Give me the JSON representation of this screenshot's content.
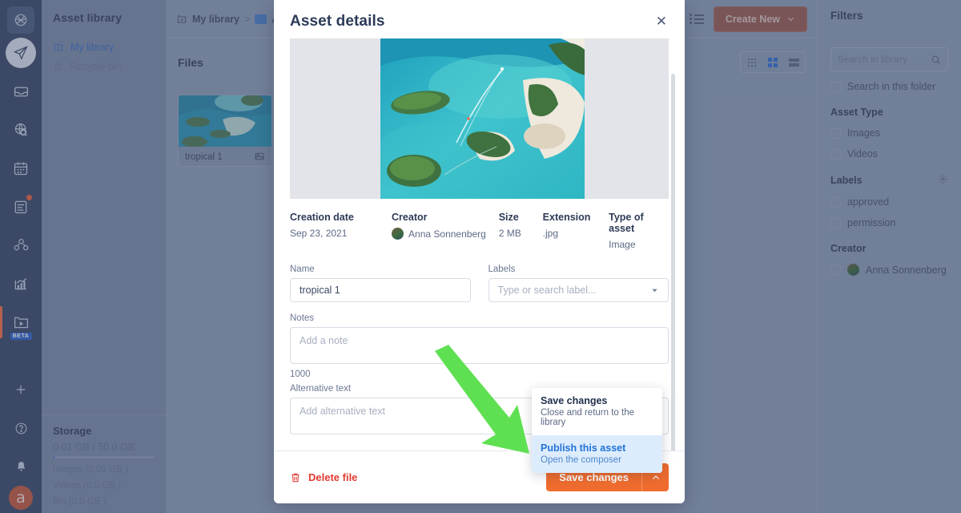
{
  "rail": {
    "logo_icon": "brand-logo-icon",
    "items": [
      {
        "name": "publisher",
        "icon": "paper-plane-icon"
      },
      {
        "name": "inbox",
        "icon": "inbox-tray-icon"
      },
      {
        "name": "monitoring",
        "icon": "globe-search-icon"
      },
      {
        "name": "calendar",
        "icon": "calendar-icon"
      },
      {
        "name": "reports",
        "icon": "clipboard-icon",
        "badge": true
      },
      {
        "name": "engagement",
        "icon": "people-icon"
      },
      {
        "name": "analytics",
        "icon": "bar-chart-icon"
      },
      {
        "name": "video-library",
        "icon": "video-folder-icon",
        "tag": "BETA"
      }
    ],
    "bottom": [
      {
        "name": "add",
        "icon": "plus-icon"
      },
      {
        "name": "help",
        "icon": "question-circle-icon"
      },
      {
        "name": "notifications",
        "icon": "bell-icon"
      }
    ],
    "avatar_letter": "a"
  },
  "sidebar": {
    "title": "Asset library",
    "items": [
      {
        "label": "My library",
        "icon": "library-folder-icon",
        "selected": true
      },
      {
        "label": "Recycle bin",
        "icon": "trash-icon",
        "selected": false
      }
    ],
    "storage": {
      "title": "Storage",
      "usage": "0.01 GB / 50.0 GB",
      "lines": [
        "Images (0.01 GB )",
        "Videos (0.0 GB )",
        "Bin (0.0 GB )"
      ]
    }
  },
  "topbar": {
    "breadcrumb": [
      {
        "label": "My library",
        "icon": "library-folder-icon"
      },
      {
        "label": "A",
        "icon": "folder-icon"
      }
    ],
    "separator": ">",
    "list_view_icon": "list-view-icon",
    "create_new_label": "Create New",
    "create_new_caret": "chevron-down-icon"
  },
  "content": {
    "files_title": "Files",
    "view_modes": [
      {
        "name": "compact-grid",
        "icon": "nine-dots-icon",
        "active": false
      },
      {
        "name": "grid",
        "icon": "four-squares-icon",
        "active": true
      },
      {
        "name": "list",
        "icon": "two-bars-icon",
        "active": false
      }
    ],
    "card": {
      "name": "tropical 1",
      "badge_icon": "image-file-icon"
    }
  },
  "filters": {
    "title": "Filters",
    "search_placeholder": "Search in library",
    "search_icon": "search-icon",
    "search_in_folder_label": "Search in this folder",
    "groups": [
      {
        "title": "Asset Type",
        "gear": false,
        "options": [
          "Images",
          "Videos"
        ]
      },
      {
        "title": "Labels",
        "gear": true,
        "gear_icon": "gear-icon",
        "options": [
          "approved",
          "permission"
        ]
      },
      {
        "title": "Creator",
        "gear": false,
        "options": [
          "Anna Sonnenberg"
        ],
        "avatar": true
      }
    ]
  },
  "modal": {
    "title": "Asset details",
    "close_icon": "close-icon",
    "meta": [
      {
        "key": "Creation date",
        "value": "Sep 23, 2021",
        "avatar": false
      },
      {
        "key": "Creator",
        "value": "Anna Sonnenberg",
        "avatar": true
      },
      {
        "key": "Size",
        "value": "2 MB",
        "avatar": false
      },
      {
        "key": "Extension",
        "value": ".jpg",
        "avatar": false
      },
      {
        "key": "Type of asset",
        "value": "Image",
        "avatar": false
      }
    ],
    "name_label": "Name",
    "name_value": "tropical 1",
    "labels_label": "Labels",
    "labels_placeholder": "Type or search label...",
    "labels_caret": "chevron-down-icon",
    "notes_label": "Notes",
    "notes_placeholder": "Add a note",
    "notes_counter": "1000",
    "alt_label": "Alternative text",
    "alt_placeholder": "Add alternative text",
    "delete_label": "Delete file",
    "delete_icon": "trash-icon",
    "save_label": "Save changes",
    "save_caret": "chevron-up-icon",
    "dropdown": [
      {
        "title": "Save changes",
        "subtitle": "Close and return to the library",
        "highlighted": false
      },
      {
        "title": "Publish this asset",
        "subtitle": "Open the composer",
        "highlighted": true
      }
    ]
  },
  "annotation": {
    "name": "green-arrow-annotation",
    "color": "#5fe052"
  },
  "colors": {
    "rail": "#3c4a66",
    "panel": "#7d8aa5",
    "accent_orange": "#ef6c2e",
    "delete_red": "#e03a2f",
    "link_blue": "#2273d6",
    "highlight_blue": "#ddecfd"
  }
}
